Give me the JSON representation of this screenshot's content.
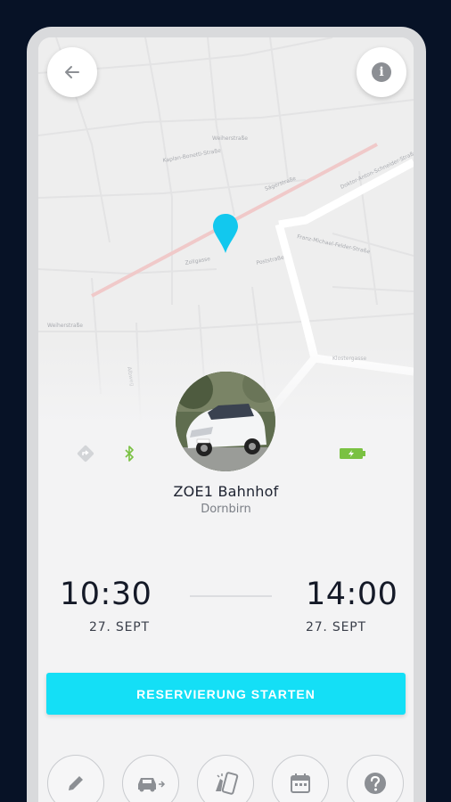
{
  "header": {
    "back_icon": "arrow-left-icon",
    "info_icon": "info-icon",
    "info_glyph": "i"
  },
  "vehicle": {
    "name": "ZOE1 Bahnhof",
    "location": "Dornbirn",
    "icons": [
      "directions-icon",
      "bluetooth-icon",
      "battery-charging-icon"
    ]
  },
  "reservation": {
    "start_time": "10:30",
    "start_date": "27. SEPT",
    "end_time": "14:00",
    "end_date": "27. SEPT"
  },
  "cta": {
    "label": "RESERVIERUNG STARTEN"
  },
  "actions": [
    {
      "icon": "pencil-icon"
    },
    {
      "icon": "car-key-icon"
    },
    {
      "icon": "phone-gesture-icon"
    },
    {
      "icon": "calendar-icon"
    },
    {
      "icon": "help-icon"
    }
  ],
  "colors": {
    "accent": "#14dff6",
    "map_pin": "#12c8ee",
    "battery": "#7ac142",
    "background": "#071226"
  }
}
